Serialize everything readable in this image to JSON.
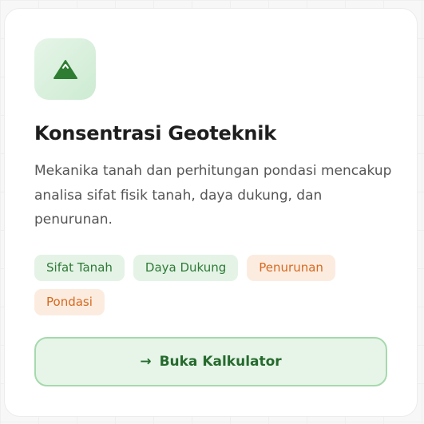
{
  "card": {
    "icon": "mountain-icon",
    "title": "Konsentrasi Geoteknik",
    "description": "Mekanika tanah dan perhitungan pondasi mencakup analisa sifat fisik tanah, daya dukung, dan penurunan.",
    "tags": [
      {
        "label": "Sifat Tanah",
        "tone": "green"
      },
      {
        "label": "Daya Dukung",
        "tone": "green"
      },
      {
        "label": "Penurunan",
        "tone": "orange"
      },
      {
        "label": "Pondasi",
        "tone": "orange"
      }
    ],
    "cta_arrow": "→",
    "cta_label": "Buka Kalkulator"
  },
  "colors": {
    "accent_green": "#2f7a37",
    "accent_orange": "#d6691f",
    "icon_green": "#2e7d32"
  }
}
